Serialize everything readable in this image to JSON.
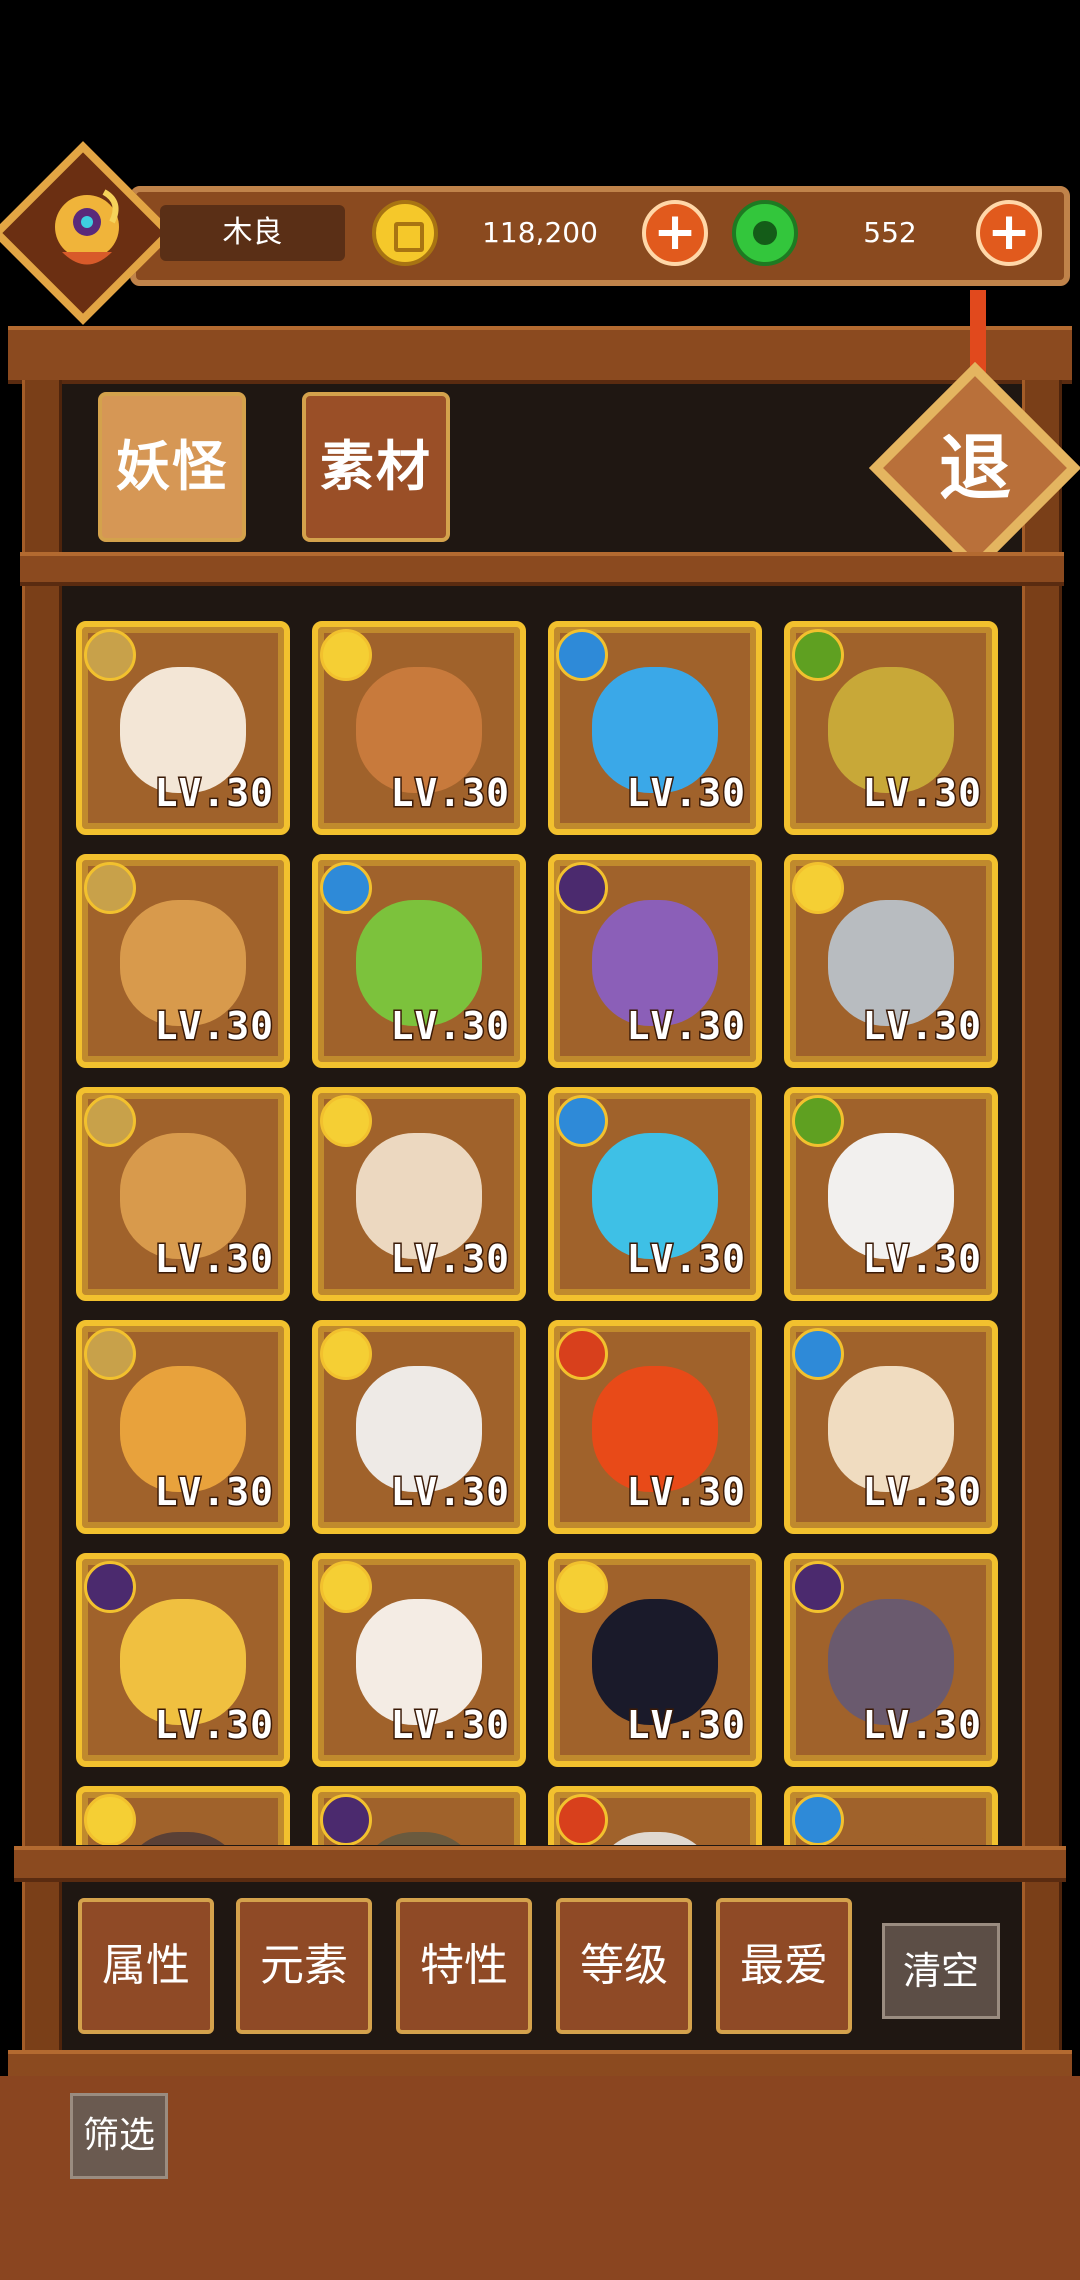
{
  "player": {
    "name": "木良",
    "coins": "118,200",
    "gems": "552"
  },
  "tabs": [
    {
      "label": "妖怪",
      "active": true
    },
    {
      "label": "素材",
      "active": false
    }
  ],
  "exit_label": "退",
  "colors": {
    "fire": "#d8401c",
    "water": "#2e8ad8",
    "leaf": "#5fa021",
    "sun": "#f5cf34",
    "earth": "#c8a14a",
    "moon": "#4b2a6e",
    "gold": "#f2c12e"
  },
  "monsters": [
    {
      "element": "earth",
      "level": "LV.30",
      "color": "#f3e6d6"
    },
    {
      "element": "sun",
      "level": "LV.30",
      "color": "#c87a3c"
    },
    {
      "element": "water",
      "level": "LV.30",
      "color": "#3aa8e8"
    },
    {
      "element": "leaf",
      "level": "LV.30",
      "color": "#c8a838"
    },
    {
      "element": "earth",
      "level": "LV.30",
      "color": "#d89a4c"
    },
    {
      "element": "water",
      "level": "LV.30",
      "color": "#7cc23c"
    },
    {
      "element": "moon",
      "level": "LV.30",
      "color": "#8b5fb8"
    },
    {
      "element": "sun",
      "level": "LV.30",
      "color": "#b8bcc0"
    },
    {
      "element": "earth",
      "level": "LV.30",
      "color": "#d89a4c"
    },
    {
      "element": "sun",
      "level": "LV.30",
      "color": "#ecd8c0"
    },
    {
      "element": "water",
      "level": "LV.30",
      "color": "#3ec0e6"
    },
    {
      "element": "leaf",
      "level": "LV.30",
      "color": "#f2f0ee"
    },
    {
      "element": "earth",
      "level": "LV.30",
      "color": "#e8a23c"
    },
    {
      "element": "sun",
      "level": "LV.30",
      "color": "#eeeae6"
    },
    {
      "element": "fire",
      "level": "LV.30",
      "color": "#e84a18"
    },
    {
      "element": "water",
      "level": "LV.30",
      "color": "#f0dcc0"
    },
    {
      "element": "moon",
      "level": "LV.30",
      "color": "#f0c040"
    },
    {
      "element": "sun",
      "level": "LV.30",
      "color": "#f4ece4"
    },
    {
      "element": "sun",
      "level": "LV.30",
      "color": "#1a1a2a"
    },
    {
      "element": "moon",
      "level": "LV.30",
      "color": "#6a5a6e"
    },
    {
      "element": "sun",
      "level": "",
      "color": "#5a4036"
    },
    {
      "element": "moon",
      "level": "",
      "color": "#6a5a3e"
    },
    {
      "element": "fire",
      "level": "",
      "color": "#e0d8d0"
    },
    {
      "element": "water",
      "level": "",
      "color": "#a0622b"
    }
  ],
  "filters": [
    "属性",
    "元素",
    "特性",
    "等级",
    "最爱"
  ],
  "clear_label": "清空",
  "filter_label": "筛选"
}
